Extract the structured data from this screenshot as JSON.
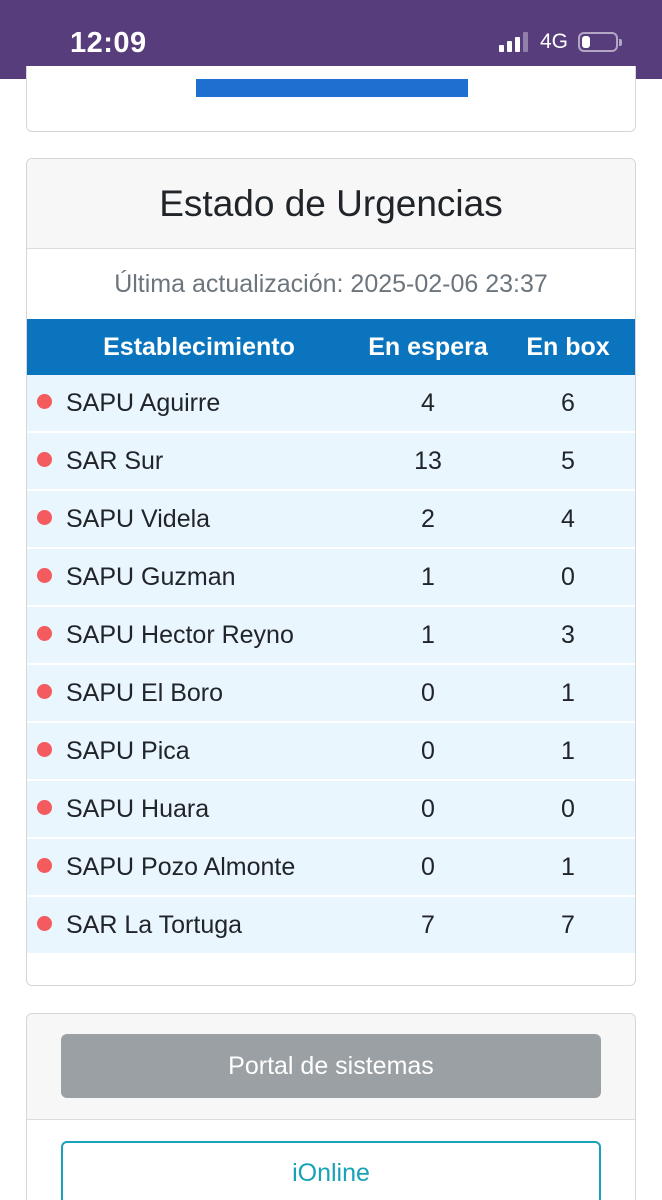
{
  "status_bar": {
    "time": "12:09",
    "network": "4G",
    "signal_bars": 4,
    "signal_bars_active": 3,
    "battery_level": 0.25,
    "background_color": "#573d7c"
  },
  "urgencias": {
    "title": "Estado de Urgencias",
    "last_update": "Última actualización: 2025-02-06 23:37",
    "columns": [
      "Establecimiento",
      "En espera",
      "En box"
    ],
    "header_color": "#0b74bf",
    "status_dot_color": "#f45b5f",
    "rows": [
      {
        "name": "SAPU Aguirre",
        "en_espera": "4",
        "en_box": "6"
      },
      {
        "name": "SAR Sur",
        "en_espera": "13",
        "en_box": "5"
      },
      {
        "name": "SAPU Videla",
        "en_espera": "2",
        "en_box": "4"
      },
      {
        "name": "SAPU Guzman",
        "en_espera": "1",
        "en_box": "0"
      },
      {
        "name": "SAPU Hector Reyno",
        "en_espera": "1",
        "en_box": "3"
      },
      {
        "name": "SAPU El Boro",
        "en_espera": "0",
        "en_box": "1"
      },
      {
        "name": "SAPU Pica",
        "en_espera": "0",
        "en_box": "1"
      },
      {
        "name": "SAPU Huara",
        "en_espera": "0",
        "en_box": "0"
      },
      {
        "name": "SAPU Pozo Almonte",
        "en_espera": "0",
        "en_box": "1"
      },
      {
        "name": "SAR La Tortuga",
        "en_espera": "7",
        "en_box": "7"
      }
    ]
  },
  "links": {
    "portal_label": "Portal de sistemas",
    "ionline_label": "iOnline"
  }
}
